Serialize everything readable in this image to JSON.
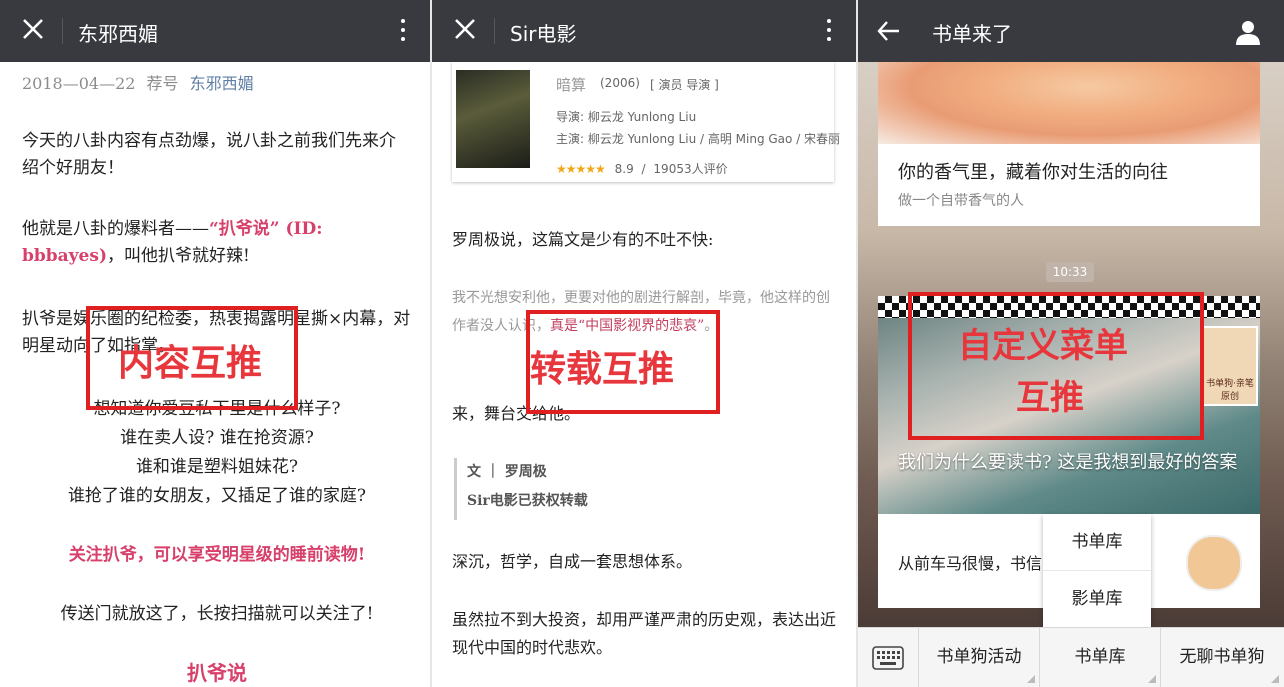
{
  "panel1": {
    "title": "东邪西媚",
    "meta_date": "2018—04—22",
    "meta_label": "荐号",
    "meta_account": "东邪西媚",
    "p1": "今天的八卦内容有点劲爆，说八卦之前我们先来介绍个好朋友！",
    "p2_a": "他就是八卦的爆料者——",
    "p2_pink": "“扒爷说” (ID: bbbayes)",
    "p2_b": "，叫他扒爷就好辣!",
    "p3": "扒爷是娱乐圈的纪检委，热衷揭露明星撕×内幕，对明星动向了如指掌。",
    "q1": "想知道你爱豆私下里是什么样子?",
    "q2": "谁在卖人设? 谁在抢资源?",
    "q3": "谁和谁是塑料姐妹花?",
    "q4": "谁抢了谁的女朋友，又插足了谁的家庭?",
    "pink_line": "关注扒爷，可以享受明星级的睡前读物!",
    "send": "传送门就放这了，长按扫描就可以关注了!",
    "footer_pink": "扒爷说",
    "label": "内容互推"
  },
  "panel2": {
    "title": "Sir电影",
    "movie_title": "暗算",
    "movie_year": "(2006)",
    "movie_tag": "[ 演员 导演 ]",
    "director": "导演: 柳云龙 Yunlong Liu",
    "cast": "主演: 柳云龙 Yunlong Liu / 高明 Ming Gao / 宋春丽",
    "stars": "★★★★★",
    "score": "8.9",
    "score_sep": "/",
    "votes": "19053人评价",
    "l1": "罗周极说，这篇文是少有的不吐不快:",
    "l2_a": "我不光想安利他，更要对他的剧进行解剖，毕竟，他这样的创作者没人认识，",
    "l2_b": "真是“中国影视界的悲哀”",
    "l2_c": "。",
    "l3": "来，舞台交给他。",
    "q_author": "文 ｜ 罗周极",
    "q_auth": "Sir电影已获权转载",
    "l4": "深沉，哲学，自成一套思想体系。",
    "l5": "虽然拉不到大投资，却用严谨严肃的历史观，表达出近现代中国的时代悲欢。",
    "label": "转载互推"
  },
  "panel3": {
    "title": "书单来了",
    "card1_title": "你的香气里，藏着你对生活的向往",
    "card1_sub": "做一个自带香气的人",
    "time": "10:33",
    "book_caption": "我们为什么要读书? 这是我想到最好的答案",
    "badge_text": "书单狗·亲笔原创",
    "bottom_text": "从前车马很慢，书信",
    "popup": [
      "书单库",
      "影单库"
    ],
    "menu": [
      "书单狗活动",
      "书单库",
      "无聊书单狗"
    ],
    "label_line1": "自定义菜单",
    "label_line2": "互推"
  }
}
